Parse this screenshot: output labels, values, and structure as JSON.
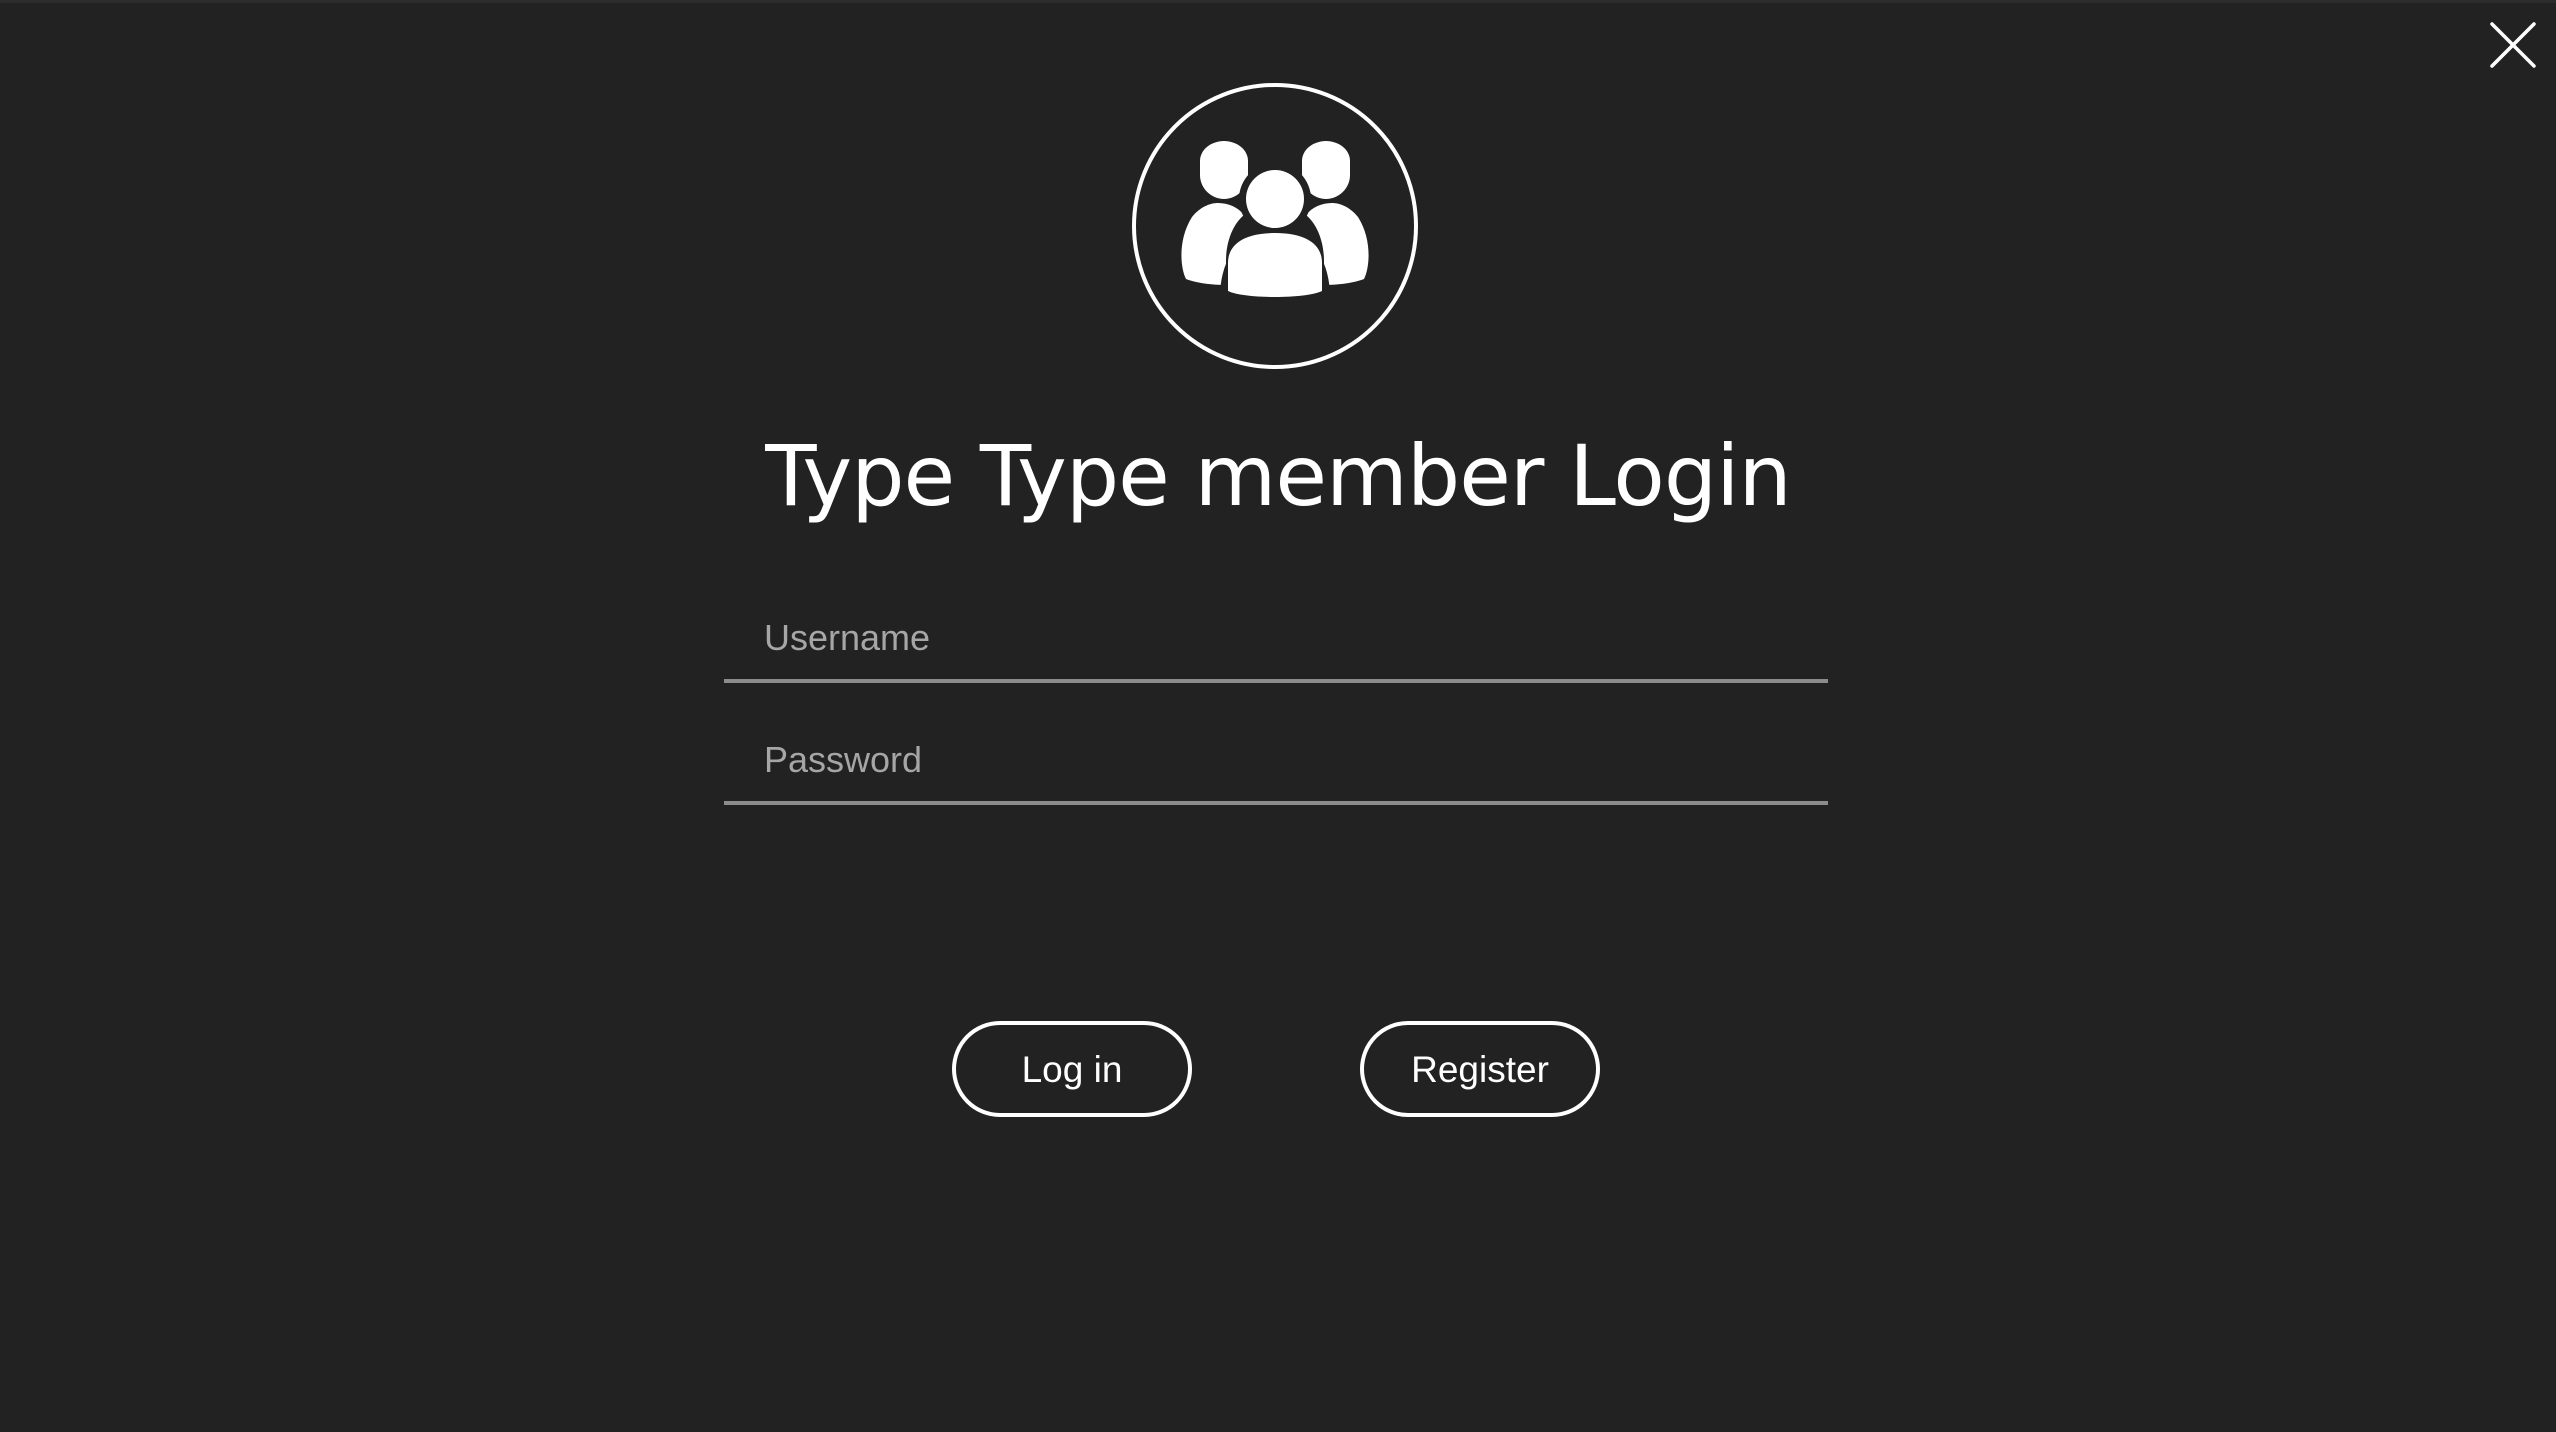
{
  "dialog": {
    "title": "Type Type member Login",
    "icons": {
      "close": "close-icon",
      "header": "group-icon"
    }
  },
  "form": {
    "username": {
      "placeholder": "Username",
      "value": ""
    },
    "password": {
      "placeholder": "Password",
      "value": ""
    }
  },
  "actions": {
    "login_label": "Log in",
    "register_label": "Register"
  },
  "colors": {
    "background": "#222222",
    "foreground": "#ffffff",
    "placeholder": "#a6a6a6",
    "field_underline": "#8c8c8c"
  }
}
